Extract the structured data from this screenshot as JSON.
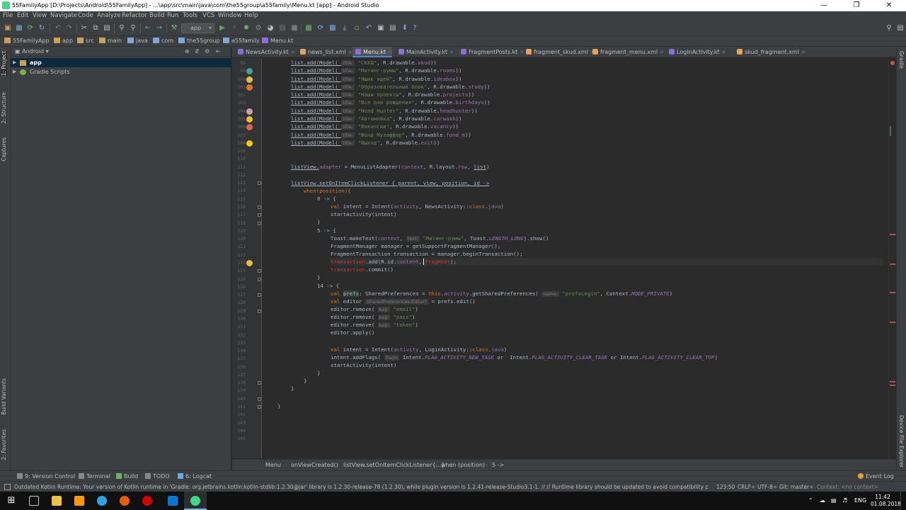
{
  "window": {
    "title": "55FamilyApp [D:\\Projects\\Android\\55FamilyApp] - ...\\app\\src\\main\\java\\com\\the55group\\a55family\\Menu.kt [app] - Android Studio"
  },
  "menu": [
    "File",
    "Edit",
    "View",
    "Navigate",
    "Code",
    "Analyze",
    "Refactor",
    "Build",
    "Run",
    "Tools",
    "VCS",
    "Window",
    "Help"
  ],
  "toolbar": {
    "run_config": "app"
  },
  "nav_crumbs": [
    "55FamilyApp",
    "app",
    "src",
    "main",
    "java",
    "com",
    "the55group",
    "a55family",
    "Menu.kt"
  ],
  "left_tabs": [
    "1: Project",
    "2: Structure",
    "Captures",
    "Build Variants",
    "2: Favorites"
  ],
  "right_tabs": [
    "Gradle",
    "Device File Explorer"
  ],
  "project": {
    "view_mode": "Android",
    "tree": [
      {
        "label": "app",
        "icon": "folder-icon",
        "selected": true
      },
      {
        "label": "Gradle Scripts",
        "icon": "gradle-icon",
        "selected": false
      }
    ]
  },
  "tabs": [
    {
      "label": "NewsActivity.kt",
      "color": "#8a6fd6",
      "active": false
    },
    {
      "label": "news_list.xml",
      "color": "#e6a15a",
      "active": false
    },
    {
      "label": "Menu.kt",
      "color": "#8a6fd6",
      "active": true
    },
    {
      "label": "MainActivity.kt",
      "color": "#8a6fd6",
      "active": false
    },
    {
      "label": "FragmentPosts.kt",
      "color": "#8a6fd6",
      "active": false
    },
    {
      "label": "fragment_skud.xml",
      "color": "#e6a15a",
      "active": false
    },
    {
      "label": "fragment_menu.xml",
      "color": "#e6a15a",
      "active": false
    },
    {
      "label": "LoginActivity.kt",
      "color": "#8a6fd6",
      "active": false
    },
    {
      "label": "skud_fragment.xml",
      "color": "#e6a15a",
      "active": false
    }
  ],
  "editor": {
    "line_numbers": [
      "98",
      "99",
      "100",
      "101",
      "102",
      "103",
      "104",
      "105",
      "106",
      "107",
      "108",
      "109",
      "110",
      "111",
      "112",
      "113",
      "114",
      "115",
      "116",
      "117",
      "118",
      "119",
      "120",
      "121",
      "122",
      "123",
      "124",
      "125",
      "126",
      "127",
      "128",
      "129",
      "130",
      "131",
      "132",
      "133",
      "134",
      "135",
      "136",
      "137",
      "138",
      "139",
      "140",
      "141",
      "142",
      "143",
      "144",
      "145"
    ],
    "list_lines": [
      {
        "pre": "list.add(Model( ",
        "ph": "title:",
        "str": "\"СКУД\"",
        "mid": ", R.drawable.",
        "fld": "skud",
        "end": "))"
      },
      {
        "pre": "list.add(Model( ",
        "ph": "title:",
        "str": "\"Митинг-румы\"",
        "mid": ", R.drawable.",
        "fld": "rooms",
        "end": "))"
      },
      {
        "pre": "list.add(Model( ",
        "ph": "title:",
        "str": "\"Ящик идей\"",
        "mid": ", R.drawable.",
        "fld": "ideabox",
        "end": "))"
      },
      {
        "pre": "list.add(Model( ",
        "ph": "title:",
        "str": "\"Образовательный блок\"",
        "mid": ", R.drawable.",
        "fld": "study",
        "end": "))"
      },
      {
        "pre": "list.add(Model( ",
        "ph": "title:",
        "str": "\"Наши проекты\"",
        "mid": ", R.drawable.",
        "fld": "projects",
        "end": "))"
      },
      {
        "pre": "list.add(Model( ",
        "ph": "title:",
        "str": "\"Все дни рождения\"",
        "mid": ", R.drawable.",
        "fld": "birthdays",
        "end": "))"
      },
      {
        "pre": "list.add(Model( ",
        "ph": "title:",
        "str": "\"Head Hunter\"",
        "mid": ", R.drawable.",
        "fld": "headhunter",
        "end": "))"
      },
      {
        "pre": "list.add(Model( ",
        "ph": "title:",
        "str": "\"Автомойка\"",
        "mid": ", R.drawable.",
        "fld": "carwash",
        "end": "))"
      },
      {
        "pre": "list.add(Model( ",
        "ph": "title:",
        "str": "\"Вакансии\"",
        "mid": ", R.drawable.",
        "fld": "vacancy",
        "end": "))"
      },
      {
        "pre": "list.add(Model( ",
        "ph": "title:",
        "str": "\"Фонд Музаффар\"",
        "mid": ", R.drawable.",
        "fld": "fond_m",
        "end": "))"
      },
      {
        "pre": "list.add(Model( ",
        "ph": "title:",
        "str": "\"Выход\"",
        "mid": ", R.drawable.",
        "fld": "exit",
        "end": "))"
      }
    ],
    "adapter_line": {
      "a": "listView.",
      "b": "adapter",
      "c": " = MenuListAdapter(",
      "d": "context",
      "e": ", R.layout.",
      "f": "row",
      "g": ", ",
      "h": "list",
      "i": ")"
    },
    "listener_line": "listView.setOnItemClickListener { parent, view, position, id ->",
    "when_line": "when(position){",
    "case0": "0 -> {",
    "intent_news": {
      "kw": "val",
      "a": " intent = Intent(",
      "b": "activity",
      "c": ", NewsActivity::",
      "d": "class",
      "e": ".",
      "f": "java",
      "g": ")"
    },
    "start_activity": "startActivity(intent)",
    "close_brace": "}",
    "case5": "5 -> {",
    "toast": {
      "a": "Toast.makeText(",
      "b": "context",
      "c": ", ",
      "ph": "text:",
      "str": "\"Митинг-румы\"",
      "d": ", Toast.",
      "e": "LENGTH_LONG",
      "f": ").show()"
    },
    "fm_line": "FragmentManager manager = getSupportFragmentManager();",
    "ft_line": "FragmentTransaction transaction = manager.beginTransaction();",
    "add_line": {
      "a": "transaction",
      "b": ".add(R.id.",
      "c": "content",
      "d": ", ",
      "e": "fragment",
      "f": ");"
    },
    "commit_line": {
      "a": "transaction",
      "b": ".commit()"
    },
    "case14": "14 -> {",
    "prefs_line": {
      "kw": "val",
      "a": " ",
      "b": "prefs",
      "c": ": SharedPreferences = ",
      "d": "this",
      "e": ".",
      "f": "activity",
      "g": ".getSharedPreferences( ",
      "ph": "name:",
      "str": "\"prefsLogin\"",
      "h": ", Context.",
      "i": "MODE_PRIVATE",
      "j": ")"
    },
    "editor_line": {
      "kw": "val",
      "a": " editor ",
      "ph": "SharedPreferences.Editor!",
      "b": " = prefs.edit()"
    },
    "remove_email": {
      "a": "editor.remove( ",
      "ph": "key:",
      "str": "\"email\"",
      "b": ")"
    },
    "remove_pass": {
      "a": "editor.remove( ",
      "ph": "key:",
      "str": "\"pass\"",
      "b": ")"
    },
    "remove_token": {
      "a": "editor.remove( ",
      "ph": "key:",
      "str": "\"token\"",
      "b": ")"
    },
    "apply_line": "editor.apply()",
    "intent_login": {
      "kw": "val",
      "a": " intent = Intent(",
      "b": "activity",
      "c": ", LoginActivity::",
      "d": "class",
      "e": ".",
      "f": "java",
      "g": ")"
    },
    "flags_line": {
      "a": "intent.addFlags( ",
      "ph": "flags:",
      "b": " Intent.",
      "c": "FLAG_ACTIVITY_NEW_TASK",
      "d": " or  Intent.",
      "e": "FLAG_ACTIVITY_CLEAR_TASK",
      "f": " or Intent.",
      "g": "FLAG_ACTIVITY_CLEAR_TOP",
      "h": ")"
    }
  },
  "breadcrumb": [
    "Menu",
    "onViewCreated()",
    "listView.setOnItemClickListener{...}",
    "when (position)",
    "5 ->"
  ],
  "tool_windows": [
    {
      "label": "9: Version Control",
      "icon": "vcs-icon"
    },
    {
      "label": "Terminal",
      "icon": "terminal-icon"
    },
    {
      "label": "Build",
      "icon": "build-icon"
    },
    {
      "label": "TODO",
      "icon": "todo-icon"
    },
    {
      "label": "6: Logcat",
      "icon": "logcat-icon"
    }
  ],
  "event_log": "Event Log",
  "status": {
    "message": "Outdated Kotlin Runtime: Your version of Kotlin runtime in 'Gradle: org.jetbrains.kotlin:kotlin-stdlib:1.2.30@jar' library is 1.2.30-release-78 (1.2.30), while plugin version is 1.2.41-release-Studio3.1-1. // // Runtime library should be updated to avoid compatibility pr... (18 minutes ago)",
    "position": "123:50",
    "line_sep": "CRLF÷",
    "encoding": "UTF-8÷",
    "git": "Git: master÷",
    "context": "Context: <no context>"
  },
  "taskbar": {
    "lang": "ENG",
    "time": "11:42",
    "date": "01.08.2018"
  },
  "colors": {
    "editor_bg": "#2b2b2b",
    "panel_bg": "#3c3f41",
    "string": "#6a8759",
    "field": "#9876aa",
    "keyword": "#cc7832"
  }
}
